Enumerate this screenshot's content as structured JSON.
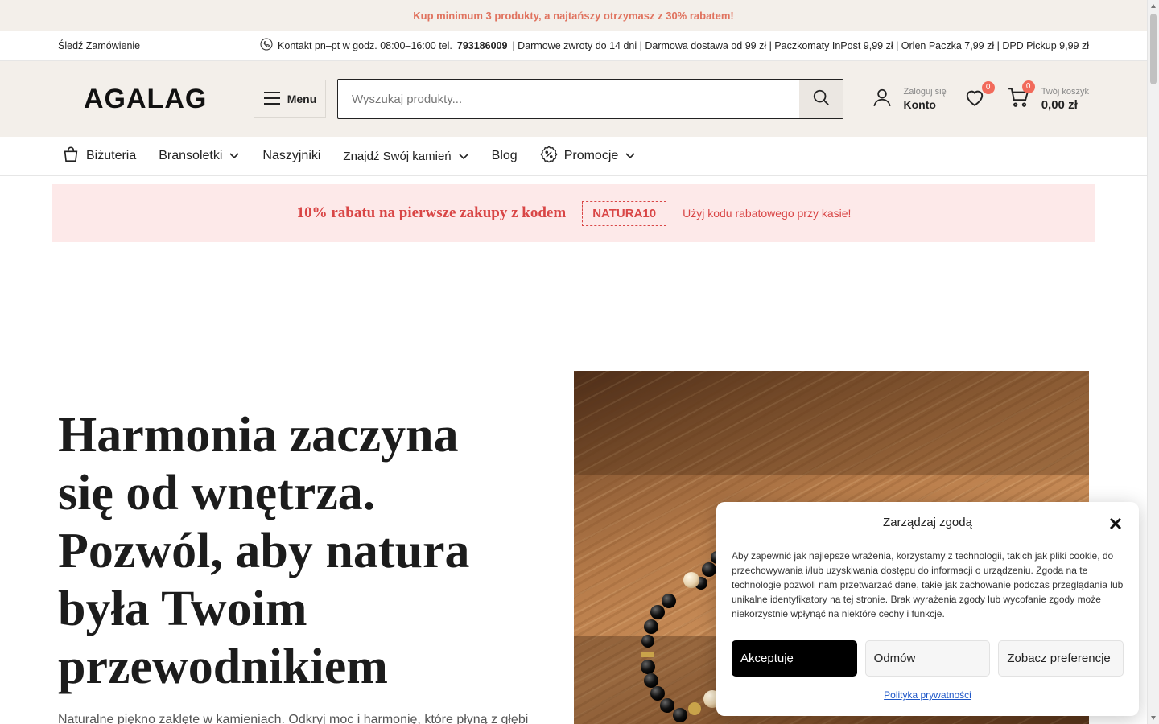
{
  "announcement": {
    "text": "Kup minimum 3 produkty, a najtańszy otrzymasz z 30% rabatem!"
  },
  "topbar": {
    "track_order": "Śledź Zamówienie",
    "contact_prefix": "Kontakt pn–pt w godz. 08:00–16:00 tel.",
    "phone": "793186009",
    "info_rest": "| Darmowe zwroty do 14 dni | Darmowa dostawa od 99 zł | Paczkomaty InPost 9,99 zł | Orlen Paczka 7,99 zł | DPD Pickup 9,99 zł"
  },
  "header": {
    "logo": "AGALAG",
    "menu_label": "Menu",
    "search_placeholder": "Wyszukaj produkty...",
    "account_small": "Zaloguj się",
    "account_label": "Konto",
    "wishlist_count": "0",
    "cart_count": "0",
    "cart_small": "Twój koszyk",
    "cart_total": "0,00 zł"
  },
  "nav": {
    "items": [
      {
        "label": "Biżuteria",
        "icon": "shopping-bag-icon",
        "dropdown": false
      },
      {
        "label": "Bransoletki",
        "dropdown": true
      },
      {
        "label": "Naszyjniki",
        "dropdown": false
      },
      {
        "label": "Znajdź Swój kamień",
        "dropdown": true
      },
      {
        "label": "Blog",
        "dropdown": false
      },
      {
        "label": "Promocje",
        "icon": "discount-badge-icon",
        "dropdown": true
      }
    ]
  },
  "promo": {
    "title": "10% rabatu na pierwsze zakupy z kodem",
    "code": "NATURA10",
    "hint": "Użyj kodu rabatowego przy kasie!"
  },
  "hero": {
    "title_lines": [
      "Harmonia zaczyna",
      "się od wnętrza.",
      "Pozwól, aby natura",
      "była Twoim",
      "przewodnikiem"
    ],
    "subtitle": "Naturalne piękno zaklęte w kamieniach. Odkryj moc i harmonię, które płyną z głębi"
  },
  "cookie": {
    "title": "Zarządzaj zgodą",
    "text": "Aby zapewnić jak najlepsze wrażenia, korzystamy z technologii, takich jak pliki cookie, do przechowywania i/lub uzyskiwania dostępu do informacji o urządzeniu. Zgoda na te technologie pozwoli nam przetwarzać dane, takie jak zachowanie podczas przeglądania lub unikalne identyfikatory na tej stronie. Brak wyrażenia zgody lub wycofanie zgody może niekorzystnie wpłynąć na niektóre cechy i funkcje.",
    "accept": "Akceptuję",
    "deny": "Odmów",
    "preferences": "Zobacz preferencje",
    "privacy_link": "Polityka prywatności"
  },
  "colors": {
    "accent": "#e0735f",
    "promo_red": "#d94646",
    "header_bg": "#f3efea",
    "badge": "#f26a5b"
  }
}
